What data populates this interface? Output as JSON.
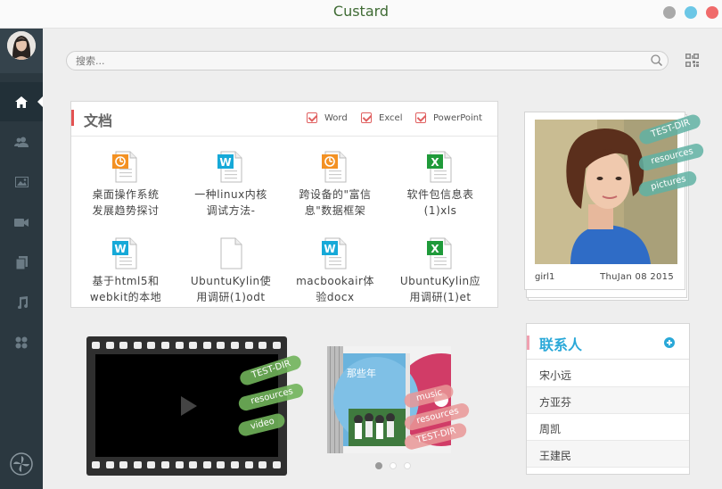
{
  "window": {
    "title": "Custard",
    "controls": [
      {
        "name": "minimize",
        "color": "#a9a9a9"
      },
      {
        "name": "maximize",
        "color": "#6cc7e6"
      },
      {
        "name": "close",
        "color": "#f06b6b"
      }
    ]
  },
  "sidebar": {
    "items": [
      {
        "icon": "home-icon",
        "active": true
      },
      {
        "icon": "contacts-icon"
      },
      {
        "icon": "picture-icon"
      },
      {
        "icon": "video-icon"
      },
      {
        "icon": "documents-icon"
      },
      {
        "icon": "music-icon"
      },
      {
        "icon": "apps-icon"
      }
    ],
    "bottom_icon": "pinwheel-icon"
  },
  "search": {
    "placeholder": "搜索..."
  },
  "documents": {
    "title": "文档",
    "filters": [
      {
        "label": "Word",
        "checked": true
      },
      {
        "label": "Excel",
        "checked": true
      },
      {
        "label": "PowerPoint",
        "checked": true
      }
    ],
    "files": [
      {
        "type": "ppt",
        "line1": "桌面操作系统",
        "line2": "发展趋势探讨"
      },
      {
        "type": "word",
        "line1": "一种linux内核",
        "line2": "调试方法-"
      },
      {
        "type": "ppt",
        "line1": "跨设备的\"富信",
        "line2": "息\"数据框架"
      },
      {
        "type": "excel",
        "line1": "软件包信息表",
        "line2": "(1)xls"
      },
      {
        "type": "word",
        "line1": "基于html5和",
        "line2": "webkit的本地"
      },
      {
        "type": "blank",
        "line1": "UbuntuKylin使",
        "line2": "用调研(1)odt"
      },
      {
        "type": "word",
        "line1": "macbookair体",
        "line2": "验docx"
      },
      {
        "type": "excel",
        "line1": "UbuntuKylin应",
        "line2": "用调研(1)et"
      }
    ]
  },
  "photo": {
    "caption": "girl1",
    "date": "ThuJan 08 2015",
    "tags": [
      "TEST-DIR",
      "resources",
      "pictures"
    ]
  },
  "video": {
    "tags": [
      "TEST-DIR",
      "resources",
      "video"
    ]
  },
  "album": {
    "cover_text": "那些年",
    "tags": [
      "music",
      "resources",
      "TEST-DIR"
    ],
    "pages": 3,
    "current_page": 1
  },
  "contacts": {
    "title": "联系人",
    "list": [
      "宋小远",
      "方亚芬",
      "周凯",
      "王建民"
    ]
  }
}
